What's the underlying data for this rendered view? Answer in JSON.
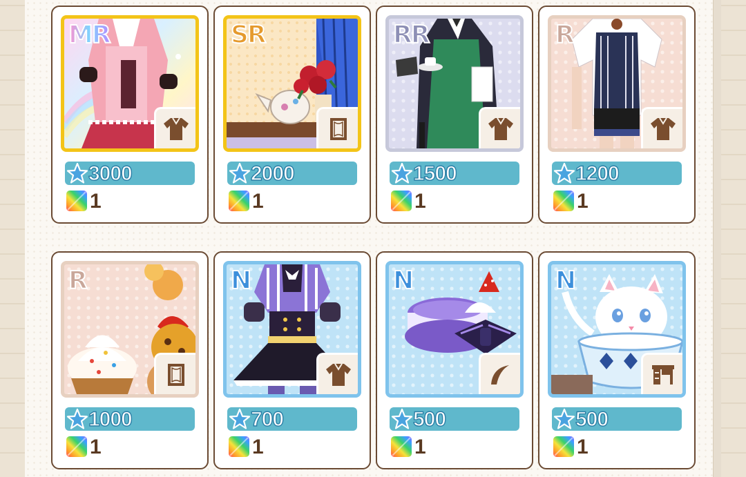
{
  "colors": {
    "card_border": "#6a4a33",
    "price_bar": "#5fb8cc",
    "star_fill": "#4aa3e0",
    "gem_count_color": "#5a3a22"
  },
  "items": [
    {
      "rarity": "MR",
      "price": "3000",
      "gems": "1",
      "type_icon": "outfit-icon",
      "art": "pink-waitress-outfit"
    },
    {
      "rarity": "SR",
      "price": "2000",
      "gems": "1",
      "type_icon": "background-card-icon",
      "art": "teapot-roses-scene"
    },
    {
      "rarity": "RR",
      "price": "1500",
      "gems": "1",
      "type_icon": "outfit-icon",
      "art": "green-apron-waiter"
    },
    {
      "rarity": "R",
      "price": "1200",
      "gems": "1",
      "type_icon": "outfit-icon",
      "art": "striped-vest-waiter"
    },
    {
      "rarity": "R",
      "price": "1000",
      "gems": "1",
      "type_icon": "background-card-icon",
      "art": "cupcake-sweets-scene"
    },
    {
      "rarity": "N",
      "price": "700",
      "gems": "1",
      "type_icon": "outfit-icon",
      "art": "purple-maid-dress"
    },
    {
      "rarity": "N",
      "price": "500",
      "gems": "1",
      "type_icon": "hair-accessory-icon",
      "art": "macaron-bow-hairpin"
    },
    {
      "rarity": "N",
      "price": "500",
      "gems": "1",
      "type_icon": "furniture-icon",
      "art": "cat-in-teacup"
    }
  ]
}
